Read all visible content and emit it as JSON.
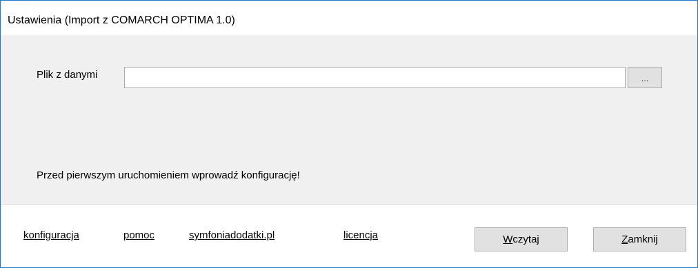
{
  "window": {
    "title": "Ustawienia (Import z COMARCH OPTIMA 1.0)"
  },
  "form": {
    "file_label": "Plik z danymi",
    "file_value": "",
    "browse_label": "...",
    "notice": "Przed pierwszym uruchomieniem wprowadź konfigurację!"
  },
  "footer": {
    "links": [
      "konfiguracja",
      "pomoc",
      "symfoniadodatki.pl",
      "licencja"
    ],
    "load_button": {
      "mnemonic": "W",
      "rest": "czytaj"
    },
    "close_button": {
      "mnemonic": "Z",
      "rest": "amknij"
    }
  }
}
